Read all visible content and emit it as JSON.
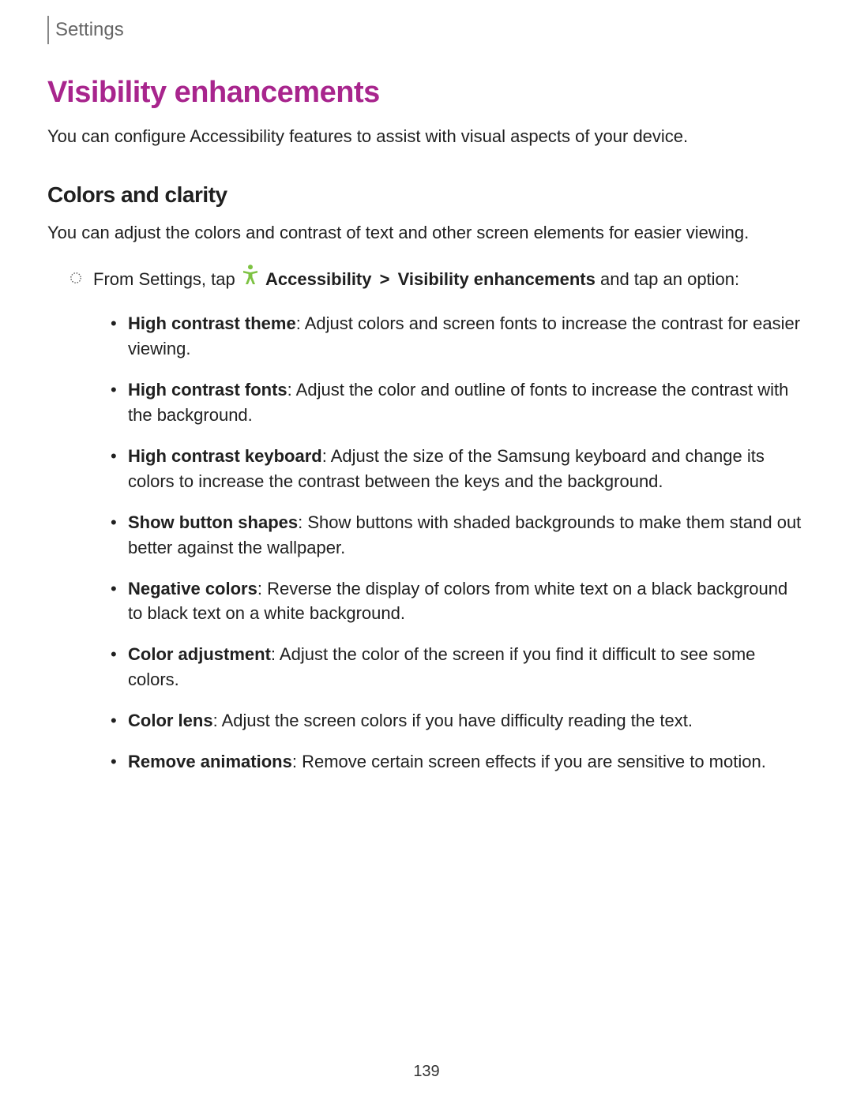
{
  "header": {
    "label": "Settings"
  },
  "page": {
    "title": "Visibility enhancements",
    "intro": "You can configure Accessibility features to assist with visual aspects of your device.",
    "page_number": "139"
  },
  "section": {
    "title": "Colors and clarity",
    "text": "You can adjust the colors and contrast of text and other screen elements for easier viewing."
  },
  "instruction": {
    "prefix": "From Settings, tap ",
    "accessibility_label": "Accessibility",
    "chevron": ">",
    "path_label": "Visibility enhancements",
    "suffix": " and tap an option:"
  },
  "options": [
    {
      "name": "High contrast theme",
      "desc": ": Adjust colors and screen fonts to increase the contrast for easier viewing."
    },
    {
      "name": "High contrast fonts",
      "desc": ": Adjust the color and outline of fonts to increase the contrast with the background."
    },
    {
      "name": "High contrast keyboard",
      "desc": ": Adjust the size of the Samsung keyboard and change its colors to increase the contrast between the keys and the background."
    },
    {
      "name": "Show button shapes",
      "desc": ": Show buttons with shaded backgrounds to make them stand out better against the wallpaper."
    },
    {
      "name": "Negative colors",
      "desc": ": Reverse the display of colors from white text on a black background to black text on a white background."
    },
    {
      "name": "Color adjustment",
      "desc": ": Adjust the color of the screen if you find it difficult to see some colors."
    },
    {
      "name": "Color lens",
      "desc": ": Adjust the screen colors if you have difficulty reading the text."
    },
    {
      "name": "Remove animations",
      "desc": ": Remove certain screen effects if you are sensitive to motion."
    }
  ],
  "colors": {
    "accent": "#a8258d",
    "icon_green": "#7dc242"
  }
}
